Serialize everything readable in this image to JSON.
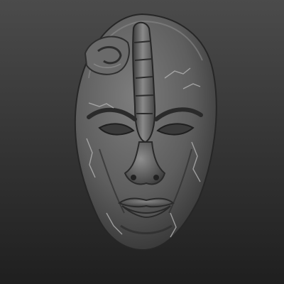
{
  "viewport": {
    "background_top_color": "#4b4b4b",
    "background_bottom_color": "#1f1f1f",
    "subject": "stone-mask-sculpt",
    "material_base_color": "#5e5e5e",
    "material_highlight_color": "#9a9a9a",
    "material_shadow_color": "#2a2a2a",
    "crack_color": "#b4b4b4"
  }
}
